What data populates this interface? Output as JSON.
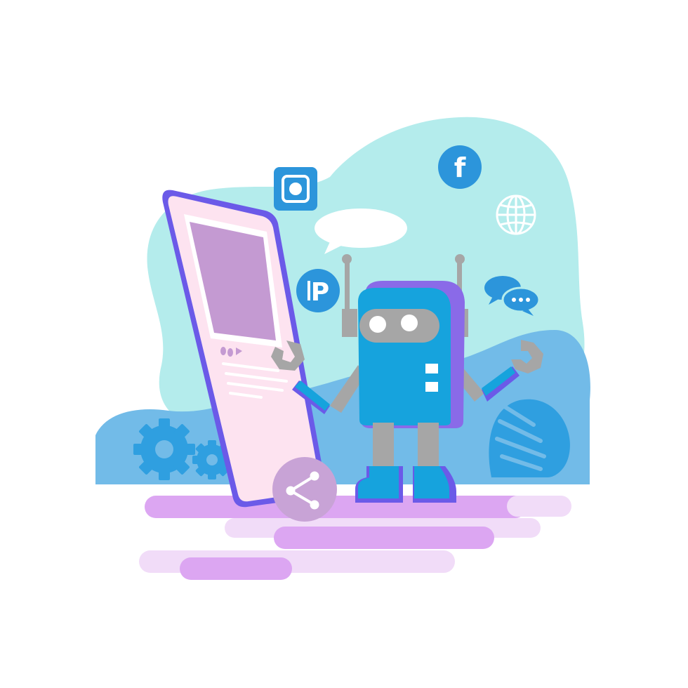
{
  "illustration": {
    "subject": "social-media-bot",
    "icons": {
      "facebook": {
        "glyph": "f"
      },
      "pinterest": {
        "glyph": "P"
      },
      "instagram": {
        "name": "instagram-icon"
      },
      "globe": {
        "name": "globe-icon"
      },
      "chat": {
        "name": "chat-bubbles-icon"
      },
      "share": {
        "name": "share-icon"
      }
    },
    "colors": {
      "blob": "#b4ecec",
      "ground_wave": "#72bbe8",
      "ground_wave_dark": "#2f9fe0",
      "icon_blue": "#2c95db",
      "phone_frame": "#6b5ae8",
      "phone_screen": "#fde3f0",
      "phone_image": "#c49ad2",
      "robot_body": "#16a3dd",
      "robot_shadow": "#8a6ae8",
      "robot_grey": "#a6a6a6",
      "floor_strong": "#dca6f2",
      "floor_light": "#f1dcf8",
      "share_circle": "#c8a3d6"
    }
  }
}
